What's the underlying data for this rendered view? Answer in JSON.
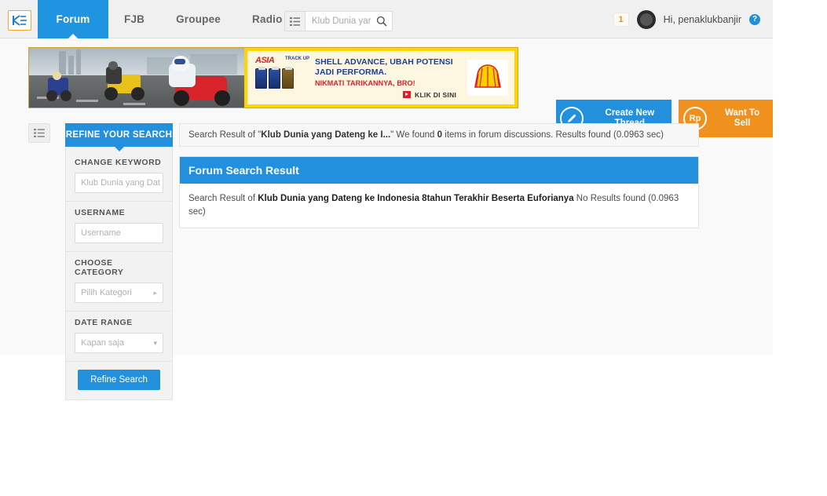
{
  "header": {
    "logo_alt": "kaskus-logo",
    "nav": [
      {
        "label": "Forum",
        "active": true
      },
      {
        "label": "FJB",
        "active": false
      },
      {
        "label": "Groupee",
        "active": false
      },
      {
        "label": "Radio",
        "active": false
      }
    ],
    "search": {
      "value": "Klub Dunia yar",
      "placeholder": "Klub Dunia yar"
    },
    "notification_count": "1",
    "greeting": "Hi, penaklukbanjir",
    "help_label": "?"
  },
  "ad": {
    "line1": "SHELL ADVANCE, UBAH POTENSI",
    "line2": "JADI PERFORMA.",
    "line3": "NIKMATI TARIKANNYA, BRO!",
    "cta": "KLIK DI SINI",
    "brand": "ASIA",
    "brand_sub": "TRACK UP"
  },
  "actions": {
    "create_thread": "Create New Thread",
    "create_thread_icon": "pencil-icon",
    "want_to_sell": "Want To Sell",
    "want_to_sell_icon": "Rp"
  },
  "sidebar": {
    "title": "REFINE YOUR SEARCH",
    "groups": [
      {
        "label": "CHANGE KEYWORD",
        "value": "Klub Dunia yang Dat",
        "placeholder": "Klub Dunia yang Dat",
        "type": "text"
      },
      {
        "label": "USERNAME",
        "value": "",
        "placeholder": "Username",
        "type": "text"
      },
      {
        "label": "CHOOSE CATEGORY",
        "value": "Pilih Kategori",
        "placeholder": "Pilih Kategori",
        "type": "chevron-right"
      },
      {
        "label": "DATE RANGE",
        "value": "Kapan saja",
        "placeholder": "Kapan saja",
        "type": "chevron-down"
      }
    ],
    "submit_label": "Refine Search"
  },
  "main": {
    "result_bar": {
      "prefix": "Search Result of \"",
      "query_short": "Klub Dunia yang Dateng ke I...",
      "suffix": "\" We found ",
      "count": "0",
      "tail": " items in forum discussions. Results found (0.0963 sec)"
    },
    "panel": {
      "title": "Forum Search Result",
      "body_prefix": "Search Result of ",
      "body_query": "Klub Dunia yang Dateng ke Indonesia 8tahun Terakhir Beserta Euforianya",
      "body_suffix": " No Results found (0.0963 sec)"
    }
  },
  "colors": {
    "accent_blue": "#2390de",
    "accent_orange": "#f0911e",
    "ad_yellow": "#ffd400",
    "page_bg": "#f9f9f9"
  }
}
